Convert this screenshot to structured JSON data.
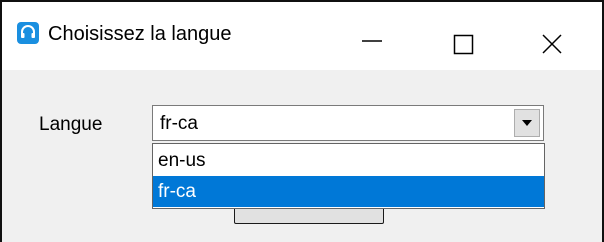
{
  "window": {
    "title": "Choisissez la langue",
    "controls": {
      "minimize_icon": "minimize-icon",
      "maximize_icon": "maximize-icon",
      "close_icon": "close-icon"
    }
  },
  "form": {
    "language_label": "Langue",
    "language_value": "fr-ca",
    "dropdown_open": true,
    "options": [
      {
        "label": "en-us",
        "selected": false
      },
      {
        "label": "fr-ca",
        "selected": true
      }
    ]
  },
  "colors": {
    "selection": "#0078d7",
    "app_icon": "#1a8fe0"
  }
}
